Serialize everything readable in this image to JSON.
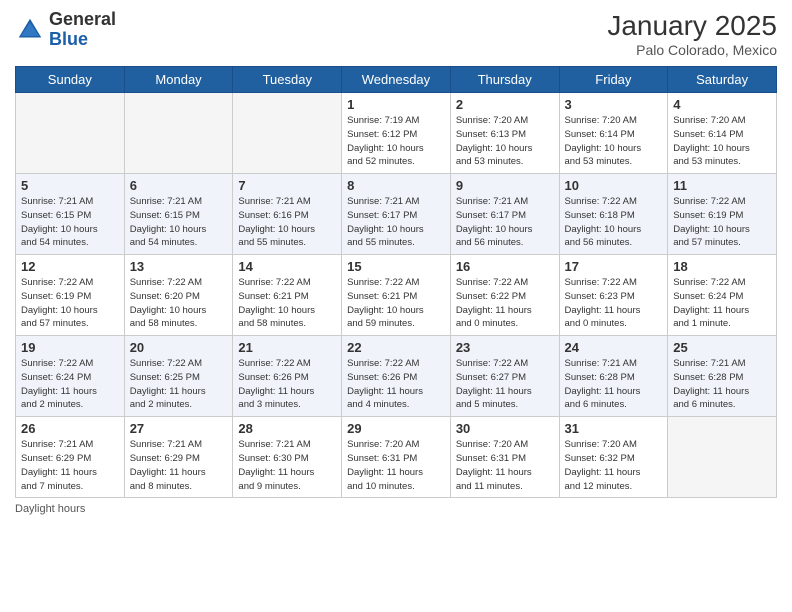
{
  "header": {
    "logo": {
      "general": "General",
      "blue": "Blue"
    },
    "title": "January 2025",
    "location": "Palo Colorado, Mexico"
  },
  "weekdays": [
    "Sunday",
    "Monday",
    "Tuesday",
    "Wednesday",
    "Thursday",
    "Friday",
    "Saturday"
  ],
  "weeks": [
    [
      {
        "day": "",
        "info": ""
      },
      {
        "day": "",
        "info": ""
      },
      {
        "day": "",
        "info": ""
      },
      {
        "day": "1",
        "info": "Sunrise: 7:19 AM\nSunset: 6:12 PM\nDaylight: 10 hours\nand 52 minutes."
      },
      {
        "day": "2",
        "info": "Sunrise: 7:20 AM\nSunset: 6:13 PM\nDaylight: 10 hours\nand 53 minutes."
      },
      {
        "day": "3",
        "info": "Sunrise: 7:20 AM\nSunset: 6:14 PM\nDaylight: 10 hours\nand 53 minutes."
      },
      {
        "day": "4",
        "info": "Sunrise: 7:20 AM\nSunset: 6:14 PM\nDaylight: 10 hours\nand 53 minutes."
      }
    ],
    [
      {
        "day": "5",
        "info": "Sunrise: 7:21 AM\nSunset: 6:15 PM\nDaylight: 10 hours\nand 54 minutes."
      },
      {
        "day": "6",
        "info": "Sunrise: 7:21 AM\nSunset: 6:15 PM\nDaylight: 10 hours\nand 54 minutes."
      },
      {
        "day": "7",
        "info": "Sunrise: 7:21 AM\nSunset: 6:16 PM\nDaylight: 10 hours\nand 55 minutes."
      },
      {
        "day": "8",
        "info": "Sunrise: 7:21 AM\nSunset: 6:17 PM\nDaylight: 10 hours\nand 55 minutes."
      },
      {
        "day": "9",
        "info": "Sunrise: 7:21 AM\nSunset: 6:17 PM\nDaylight: 10 hours\nand 56 minutes."
      },
      {
        "day": "10",
        "info": "Sunrise: 7:22 AM\nSunset: 6:18 PM\nDaylight: 10 hours\nand 56 minutes."
      },
      {
        "day": "11",
        "info": "Sunrise: 7:22 AM\nSunset: 6:19 PM\nDaylight: 10 hours\nand 57 minutes."
      }
    ],
    [
      {
        "day": "12",
        "info": "Sunrise: 7:22 AM\nSunset: 6:19 PM\nDaylight: 10 hours\nand 57 minutes."
      },
      {
        "day": "13",
        "info": "Sunrise: 7:22 AM\nSunset: 6:20 PM\nDaylight: 10 hours\nand 58 minutes."
      },
      {
        "day": "14",
        "info": "Sunrise: 7:22 AM\nSunset: 6:21 PM\nDaylight: 10 hours\nand 58 minutes."
      },
      {
        "day": "15",
        "info": "Sunrise: 7:22 AM\nSunset: 6:21 PM\nDaylight: 10 hours\nand 59 minutes."
      },
      {
        "day": "16",
        "info": "Sunrise: 7:22 AM\nSunset: 6:22 PM\nDaylight: 11 hours\nand 0 minutes."
      },
      {
        "day": "17",
        "info": "Sunrise: 7:22 AM\nSunset: 6:23 PM\nDaylight: 11 hours\nand 0 minutes."
      },
      {
        "day": "18",
        "info": "Sunrise: 7:22 AM\nSunset: 6:24 PM\nDaylight: 11 hours\nand 1 minute."
      }
    ],
    [
      {
        "day": "19",
        "info": "Sunrise: 7:22 AM\nSunset: 6:24 PM\nDaylight: 11 hours\nand 2 minutes."
      },
      {
        "day": "20",
        "info": "Sunrise: 7:22 AM\nSunset: 6:25 PM\nDaylight: 11 hours\nand 2 minutes."
      },
      {
        "day": "21",
        "info": "Sunrise: 7:22 AM\nSunset: 6:26 PM\nDaylight: 11 hours\nand 3 minutes."
      },
      {
        "day": "22",
        "info": "Sunrise: 7:22 AM\nSunset: 6:26 PM\nDaylight: 11 hours\nand 4 minutes."
      },
      {
        "day": "23",
        "info": "Sunrise: 7:22 AM\nSunset: 6:27 PM\nDaylight: 11 hours\nand 5 minutes."
      },
      {
        "day": "24",
        "info": "Sunrise: 7:21 AM\nSunset: 6:28 PM\nDaylight: 11 hours\nand 6 minutes."
      },
      {
        "day": "25",
        "info": "Sunrise: 7:21 AM\nSunset: 6:28 PM\nDaylight: 11 hours\nand 6 minutes."
      }
    ],
    [
      {
        "day": "26",
        "info": "Sunrise: 7:21 AM\nSunset: 6:29 PM\nDaylight: 11 hours\nand 7 minutes."
      },
      {
        "day": "27",
        "info": "Sunrise: 7:21 AM\nSunset: 6:29 PM\nDaylight: 11 hours\nand 8 minutes."
      },
      {
        "day": "28",
        "info": "Sunrise: 7:21 AM\nSunset: 6:30 PM\nDaylight: 11 hours\nand 9 minutes."
      },
      {
        "day": "29",
        "info": "Sunrise: 7:20 AM\nSunset: 6:31 PM\nDaylight: 11 hours\nand 10 minutes."
      },
      {
        "day": "30",
        "info": "Sunrise: 7:20 AM\nSunset: 6:31 PM\nDaylight: 11 hours\nand 11 minutes."
      },
      {
        "day": "31",
        "info": "Sunrise: 7:20 AM\nSunset: 6:32 PM\nDaylight: 11 hours\nand 12 minutes."
      },
      {
        "day": "",
        "info": ""
      }
    ]
  ],
  "footer": {
    "note": "Daylight hours"
  }
}
